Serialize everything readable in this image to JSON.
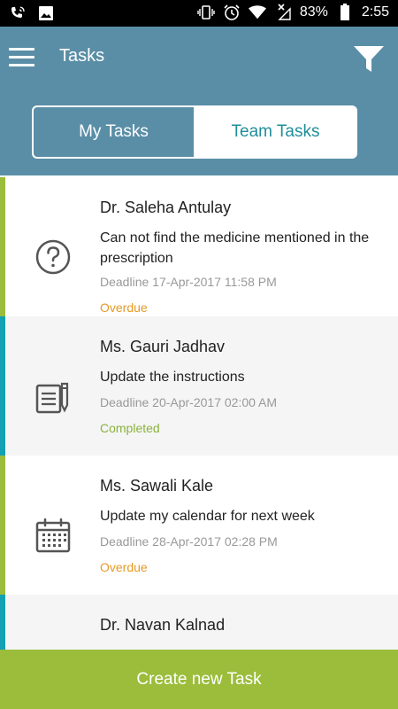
{
  "status_bar": {
    "battery": "83%",
    "time": "2:55",
    "icons": [
      "phone-wave-icon",
      "image-icon",
      "vibrate-icon",
      "alarm-icon",
      "wifi-icon",
      "signal-off-icon",
      "battery-icon"
    ]
  },
  "app_bar": {
    "title": "Tasks",
    "menu_icon": "hamburger-menu-icon",
    "filter_icon": "filter-icon"
  },
  "tabs": [
    {
      "label": "My Tasks",
      "selected": false
    },
    {
      "label": "Team Tasks",
      "selected": true
    }
  ],
  "tasks": [
    {
      "name": "Dr. Saleha Antulay",
      "description": "Can not find the medicine mentioned in the prescription",
      "deadline": "Deadline 17-Apr-2017 11:58 PM",
      "status": "Overdue",
      "icon": "question-circle-icon"
    },
    {
      "name": "Ms. Gauri Jadhav",
      "description": "Update the instructions",
      "deadline": "Deadline 20-Apr-2017 02:00 AM",
      "status": "Completed",
      "icon": "notepad-pencil-icon"
    },
    {
      "name": "Ms. Sawali Kale",
      "description": "Update my calendar for next week",
      "deadline": "Deadline 28-Apr-2017 02:28 PM",
      "status": "Overdue",
      "icon": "calendar-icon"
    },
    {
      "name": "Dr. Navan Kalnad"
    }
  ],
  "colors": {
    "app_bar": "#5a8ea7",
    "accent_green": "#9bbd3b",
    "accent_teal": "#12a0b3",
    "overdue": "#e59a25",
    "completed": "#8ab33a"
  },
  "create_button": {
    "label": "Create new Task"
  }
}
